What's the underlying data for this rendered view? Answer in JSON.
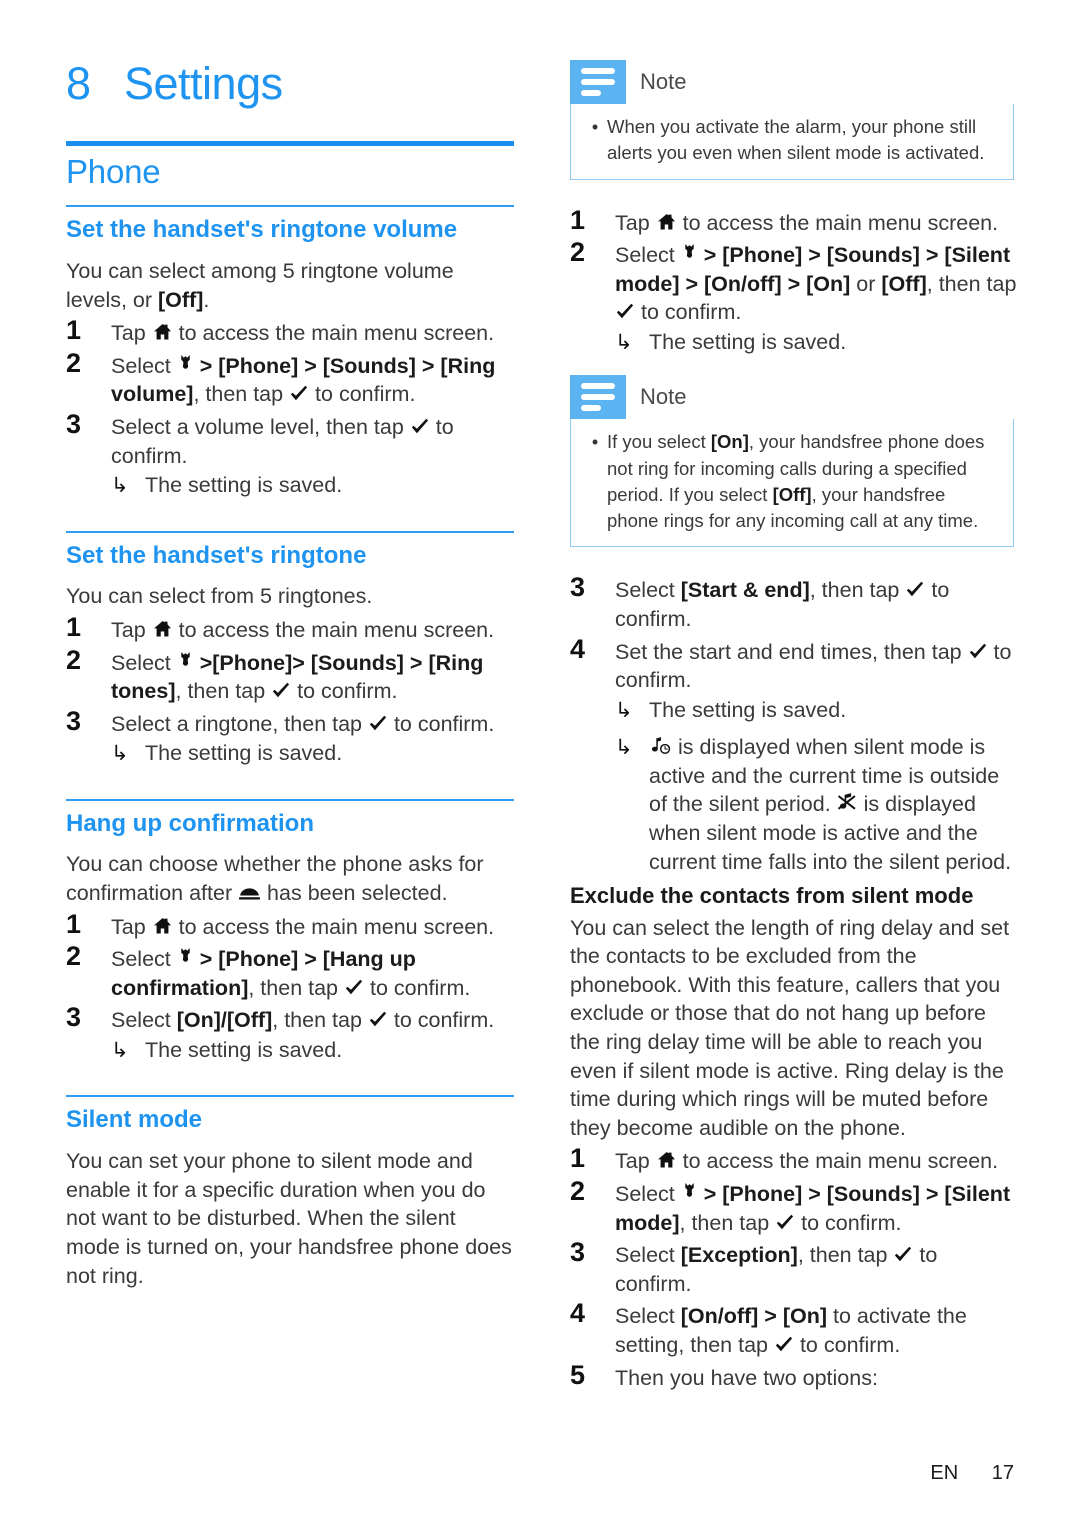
{
  "document": {
    "chapter_number": "8",
    "chapter_title": "Settings",
    "section_title": "Phone",
    "footer_language": "EN",
    "footer_page": "17",
    "accent_color": "#1e94f0",
    "note_icon_color": "#5cb3f2",
    "note_border_color": "#8fcaf5"
  },
  "icons": {
    "home": "home-icon",
    "wrench": "wrench-icon",
    "check": "check-icon",
    "hangup": "hangup-icon",
    "silent_scheduled": "note-clock-icon",
    "silent_active": "note-crossed-icon",
    "note": "note-bars-icon",
    "arrow": "↳",
    "bullet": "•"
  },
  "left_column": {
    "sections": [
      {
        "heading": "Set the handset's ringtone volume",
        "intro_a": "You can select among 5 ringtone volume levels, or ",
        "intro_b": "[Off]",
        "intro_c": ".",
        "steps": [
          {
            "n": "1",
            "pre": "Tap ",
            "mid": " to access the main menu screen."
          },
          {
            "n": "2",
            "pre": "Select ",
            "path": " > [Phone] > [Sounds] > [Ring volume]",
            "post": ", then tap ",
            "tail": " to confirm."
          },
          {
            "n": "3",
            "pre": "Select a volume level, then tap ",
            "post": " to confirm."
          }
        ],
        "result": "The setting is saved."
      },
      {
        "heading": "Set the handset's ringtone",
        "intro": "You can select from 5 ringtones.",
        "steps": [
          {
            "n": "1",
            "pre": "Tap ",
            "mid": " to access the main menu screen."
          },
          {
            "n": "2",
            "pre": "Select ",
            "path": " >[Phone]> [Sounds] > [Ring tones]",
            "post": ", then tap ",
            "tail": " to confirm."
          },
          {
            "n": "3",
            "pre": "Select a ringtone, then tap ",
            "post": " to confirm."
          }
        ],
        "result": "The setting is saved."
      },
      {
        "heading": "Hang up confirmation",
        "intro_a": "You can choose whether the phone asks for confirmation after ",
        "intro_b": " has been selected.",
        "steps": [
          {
            "n": "1",
            "pre": "Tap ",
            "mid": " to access the main menu screen."
          },
          {
            "n": "2",
            "pre": "Select ",
            "path": " > [Phone] > [Hang up confirmation]",
            "post": ", then tap ",
            "tail": " to confirm."
          },
          {
            "n": "3",
            "pre": "Select ",
            "path": "[On]/[Off]",
            "post": ", then tap ",
            "tail": " to confirm."
          }
        ],
        "result": "The setting is saved."
      },
      {
        "heading": "Silent mode",
        "intro": "You can set your phone to silent mode and enable it for a specific duration when you do not want to be disturbed. When the silent mode is turned on, your handsfree phone does not ring."
      }
    ]
  },
  "right_column": {
    "note_1": {
      "title": "Note",
      "text": "When you activate the alarm, your phone still alerts you even when silent mode is activated."
    },
    "steps_a": [
      {
        "n": "1",
        "pre": "Tap ",
        "mid": " to access the main menu screen."
      },
      {
        "n": "2",
        "pre": "Select ",
        "path": " > [Phone] > [Sounds] > [Silent mode] > [On/off] > [On]",
        "mid2": " or ",
        "path2": "[Off]",
        "post": ", then tap ",
        "tail": " to confirm."
      }
    ],
    "result_a": "The setting is saved.",
    "note_2": {
      "title": "Note",
      "text_a": "If you select ",
      "text_b": "[On]",
      "text_c": ", your handsfree phone does not ring for incoming calls during a specified period. If you select ",
      "text_d": "[Off]",
      "text_e": ", your handsfree phone rings for any incoming call at any time."
    },
    "steps_b": [
      {
        "n": "3",
        "pre": "Select ",
        "path": "[Start & end]",
        "post": ", then tap ",
        "tail": " to confirm."
      },
      {
        "n": "4",
        "pre": "Set the start and end times, then tap ",
        "post": " to confirm."
      }
    ],
    "result_b": "The setting is saved.",
    "result_c_a": " is displayed when silent mode is active and the current time is outside of the silent period. ",
    "result_c_b": " is displayed when silent mode is active and the current time falls into the silent period.",
    "subheading": "Exclude the contacts from silent mode",
    "paragraph": "You can select the length of ring delay and set the contacts to be excluded from the phonebook. With this feature, callers that you exclude or those that do not hang up before the ring delay time will be able to reach you even if silent mode is active. Ring delay is the time during which rings will be muted before they become audible on the phone.",
    "steps_c": [
      {
        "n": "1",
        "pre": "Tap ",
        "mid": " to access the main menu screen."
      },
      {
        "n": "2",
        "pre": "Select ",
        "path": " > [Phone] > [Sounds] > [Silent mode]",
        "post": ", then tap ",
        "tail": " to confirm."
      },
      {
        "n": "3",
        "pre": "Select ",
        "path": "[Exception]",
        "post": ", then tap ",
        "tail": " to confirm."
      },
      {
        "n": "4",
        "pre": "Select ",
        "path": "[On/off] > [On]",
        "mid2": " to activate the setting, then tap ",
        "tail": " to confirm."
      },
      {
        "n": "5",
        "pre": "Then you have two options:"
      }
    ]
  }
}
